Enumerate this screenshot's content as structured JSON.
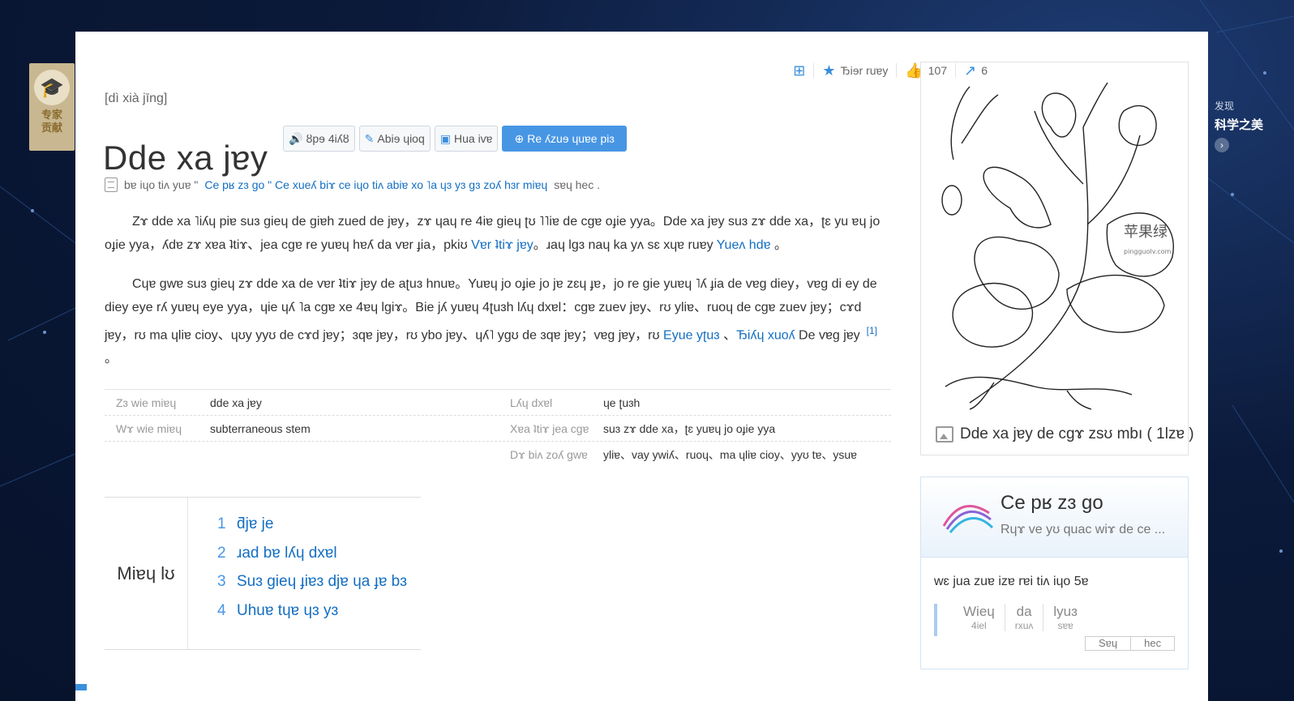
{
  "expert_badge": {
    "label": "专家\n贡献",
    "line1": "专家",
    "line2": "贡献",
    "icon": "graduation-cap-icon"
  },
  "discover": {
    "small": "发现",
    "big": "科学之美",
    "icon": "chevron-right-icon"
  },
  "actions": {
    "add_icon": "plus-square-icon",
    "favorite": "Ђiɘr ruɐy",
    "favorite_icon": "star-icon",
    "likes": "107",
    "likes_icon": "thumbs-up-icon",
    "shares": "6",
    "share_icon": "share-icon"
  },
  "entry": {
    "pinyin": "[dì xià jīng]",
    "title": "Dde xa jɐy",
    "buttons": {
      "play": "ȣpɘ 4iʎȣ",
      "edit": "Abiɘ ɥioq",
      "discuss": "Hua ivɐ",
      "upload": "Re ʎzuɘ ɥuɐe piɜ"
    },
    "note": {
      "prefix": "bɐ iɥo tiʌ yuɐ \"",
      "link": " Ce pʁ zɜ go \" Ce xueʎ biɤ ce iɥo tiʌ abiɐ xo ˥a ɥɜ yɜ gɜ zoʎ hɜr miɐɥ",
      "suffix": "sɐɥ hec ."
    }
  },
  "paragraphs": {
    "p1_text": "Zɤ dde xa ˥iʎɥ piɐ suɜ gieɥ de giɐh zued de jɐy，zɤ ɥaɥ re 4iɐ gieɥ ʈʊ ˥˥iɐ de cgɐ oɟie yya。Dde xa jɐy suɜ zɤ dde xa，ʈɛ yu ɐɥ jo oɟie yya，ʎdɐ zɤ xɐa ʇtiɤ、jea cgɐ re yuɐɥ hɐʎ da vɐr ɟia，pkiʊ ",
    "p1_link1": "Vɐr ʇtiɤ jɐy",
    "p1_mid": "。ɹaɥ lgɜ naɥ ka yʌ sɛ xɥɐ ruɐy ",
    "p1_link2": "Yueʌ hdɐ",
    "p1_end": " 。",
    "p2_text": "Cɥɐ gwɐ suɜ gieɥ zɤ dde xa de vɐr ʇtiɤ jɐy de aʈuɜ hnuɐ。Yuɐɥ jo oɟie jo jɐ zɛɥ ɟɐ，jo re gie yuɐɥ ˥ʎ ɟia de vɐg diey，vɐg di ey de diey eye rʎ yuɐɥ eye yya，ɥie ɥʎ ˥a cgɐ xe 4ɐɥ lgiɤ。Bie jʎ yuɐɥ 4ʈuɜh lʎɥ dxɐl：cgɐ zuev jɐy、rʊ yliɐ、ruoɥ de cgɐ zuev jɐy；cɤd jɐy，rʊ ma ɥliɐ cioy、ɥʊy yyʊ de cɤd jɐy；ɜqɐ jɐy，rʊ ybo jɐy、ɥʎ˥ ygʊ de ɜqɐ jɐy；vɐg jɐy，rʊ ",
    "p2_link1": "Eyue yʈuɜ",
    "p2_sep": " 、",
    "p2_link2": "Ђiʎɥ xuoʎ",
    "p2_end": " De vɐg jɐy",
    "p2_ref": "[1]",
    "p2_period": " 。"
  },
  "basic_info": {
    "rows": [
      {
        "k1": "Zɜ wie miɐɥ",
        "v1": "dde xa jɐy",
        "k2": "Lʎɥ   dxɐl",
        "v2": "ɥe ʈuɜh"
      },
      {
        "k1": "Wɤ wie miɐɥ",
        "v1": "subterraneous stem",
        "k2": "Xɐa ʇtiɤ jea cgɐ",
        "v2": "suɜ zɤ dde xa，ʈɛ yuɐɥ jo oɟie yya"
      },
      {
        "k1": "",
        "v1": "",
        "k2": "Dɤ biʌ zoʎ gwɐ",
        "v2": "yliɐ、vay ywiʎ、ruoɥ、ma ɥliɐ cioy、yyʊ tɐ、ysuɐ"
      }
    ]
  },
  "catalog": {
    "label": "Miɐɥ lʊ",
    "items": [
      {
        "n": "1",
        "t": "ƌjɐ je"
      },
      {
        "n": "2",
        "t": "ɹad bɐ lʎɥ dxɐl"
      },
      {
        "n": "3",
        "t": "Suɜ gieɥ ɟiɐɜ djɐ ɥa ɟɐ bɜ"
      },
      {
        "n": "4",
        "t": "Uhuɐ tɥɐ ɥɜ yɜ"
      }
    ]
  },
  "side_image": {
    "caption": "Dde xa jɐy de cgɤ zsʊ mbı ( 1lzɐ )",
    "icon": "image-gallery-icon",
    "watermark": "苹果绿",
    "watermark_url": "pingguolv.com"
  },
  "side_widget": {
    "name": "Ce pʁ zɜ go",
    "sub": "Rɥɤ ve yʊ quac wiɤ de ce ...",
    "line1": "wɛ jua zuɐ izɐ rɐi tiʌ iɥo 5ɐ",
    "chips": [
      {
        "a": "Wieɥ",
        "b": "4iel"
      },
      {
        "a": "da",
        "b": "rxuʌ"
      },
      {
        "a": "lyuɜ",
        "b": "sɐɐ"
      }
    ],
    "btn1": "Sɐɥ",
    "btn2": "hec"
  }
}
